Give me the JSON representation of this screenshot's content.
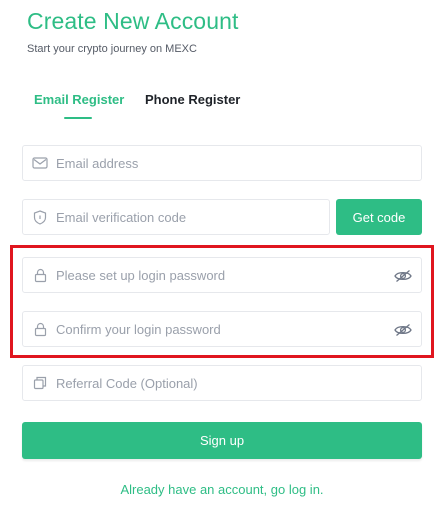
{
  "header": {
    "title": "Create New Account",
    "subtitle": "Start your crypto journey on MEXC"
  },
  "tabs": [
    {
      "label": "Email Register",
      "active": true
    },
    {
      "label": "Phone Register",
      "active": false
    }
  ],
  "form": {
    "email_placeholder": "Email address",
    "verification_placeholder": "Email verification code",
    "get_code_label": "Get code",
    "password_placeholder": "Please set up login password",
    "confirm_password_placeholder": "Confirm your login password",
    "referral_placeholder": "Referral Code (Optional)",
    "signup_label": "Sign up"
  },
  "footer": {
    "login_link": "Already have an account, go log in."
  },
  "icons": {
    "email": "mail-icon",
    "verification": "shield-icon",
    "password": "lock-icon",
    "confirm_password": "lock-icon",
    "referral": "copy-icon",
    "visibility": "eye-off-icon"
  },
  "colors": {
    "accent": "#2ebd85",
    "highlight_border": "#e0161f",
    "text_dark": "#1f2329",
    "placeholder": "#9aa0ab"
  }
}
